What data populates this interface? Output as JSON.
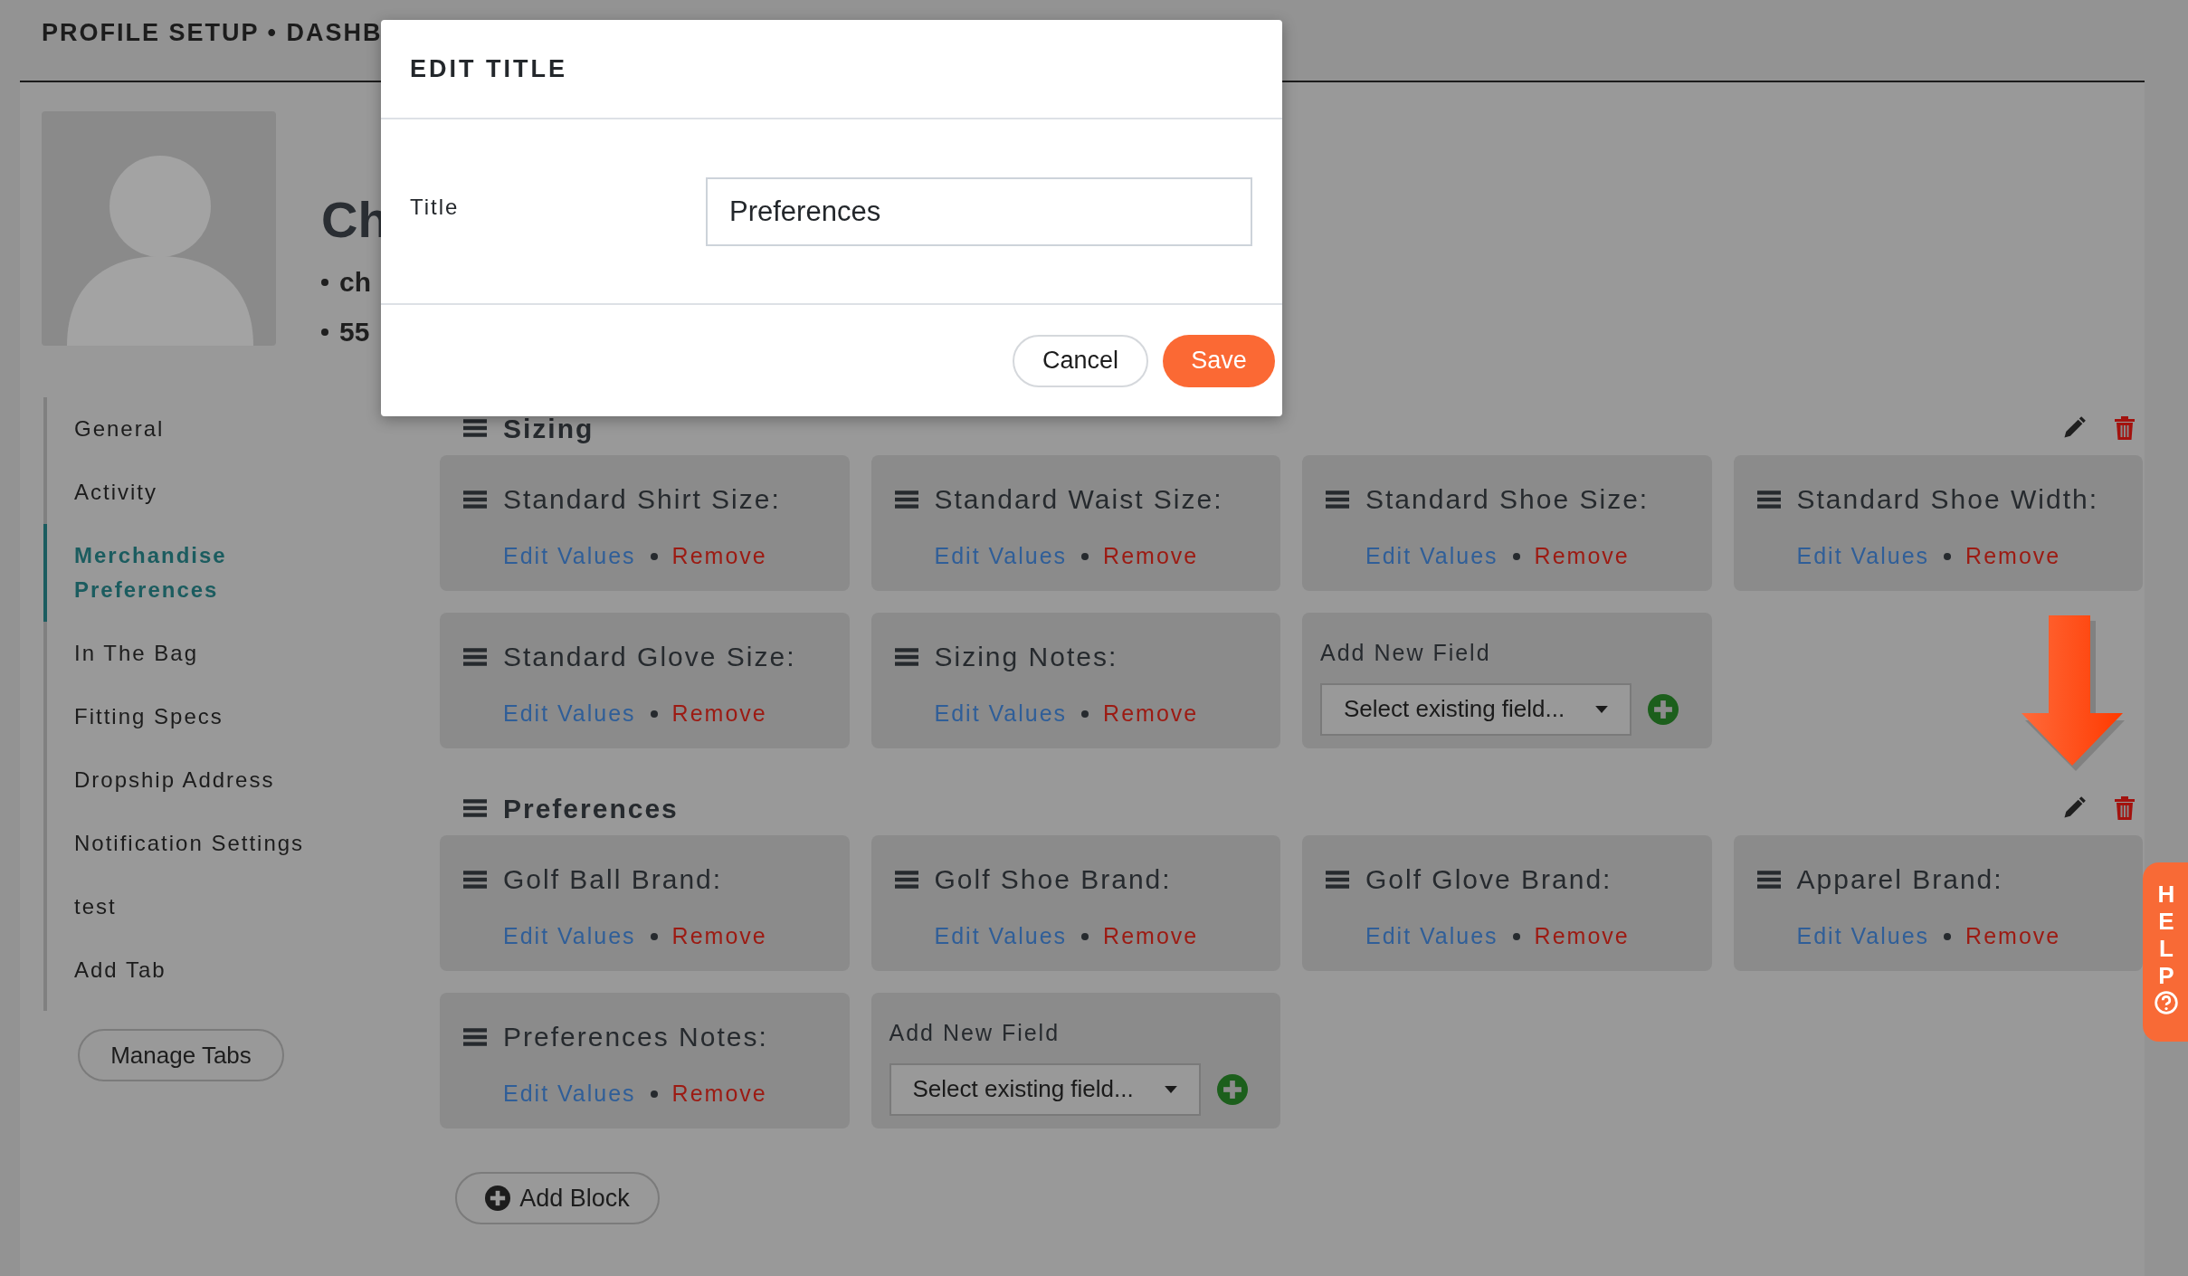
{
  "header": {
    "title": "PROFILE SETUP • DASHB"
  },
  "profile": {
    "name": "Ch",
    "details": [
      "ch",
      "55"
    ]
  },
  "sidebar": {
    "items": [
      {
        "label": "General",
        "selected": false
      },
      {
        "label": "Activity",
        "selected": false
      },
      {
        "label": "Merchandise Preferences",
        "selected": true
      },
      {
        "label": "In The Bag",
        "selected": false
      },
      {
        "label": "Fitting Specs",
        "selected": false
      },
      {
        "label": "Dropship Address",
        "selected": false
      },
      {
        "label": "Notification Settings",
        "selected": false
      },
      {
        "label": "test",
        "selected": false
      },
      {
        "label": "Add Tab",
        "selected": false
      }
    ],
    "manage_button": "Manage Tabs"
  },
  "blocks": [
    {
      "title": "Sizing",
      "fields": [
        {
          "kind": "field",
          "label": "Standard Shirt Size:",
          "edit": "Edit Values",
          "remove": "Remove"
        },
        {
          "kind": "field",
          "label": "Standard Waist Size:",
          "edit": "Edit Values",
          "remove": "Remove"
        },
        {
          "kind": "field",
          "label": "Standard Shoe Size:",
          "edit": "Edit Values",
          "remove": "Remove"
        },
        {
          "kind": "field",
          "label": "Standard Shoe Width:",
          "edit": "Edit Values",
          "remove": "Remove"
        },
        {
          "kind": "field",
          "label": "Standard Glove Size:",
          "edit": "Edit Values",
          "remove": "Remove"
        },
        {
          "kind": "field",
          "label": "Sizing Notes:",
          "edit": "Edit Values",
          "remove": "Remove"
        },
        {
          "kind": "add",
          "label": "Add New Field",
          "select": "Select existing field..."
        }
      ]
    },
    {
      "title": "Preferences",
      "fields": [
        {
          "kind": "field",
          "label": "Golf Ball Brand:",
          "edit": "Edit Values",
          "remove": "Remove"
        },
        {
          "kind": "field",
          "label": "Golf Shoe Brand:",
          "edit": "Edit Values",
          "remove": "Remove"
        },
        {
          "kind": "field",
          "label": "Golf Glove Brand:",
          "edit": "Edit Values",
          "remove": "Remove"
        },
        {
          "kind": "field",
          "label": "Apparel Brand:",
          "edit": "Edit Values",
          "remove": "Remove"
        },
        {
          "kind": "field",
          "label": "Preferences Notes:",
          "edit": "Edit Values",
          "remove": "Remove"
        },
        {
          "kind": "add",
          "label": "Add New Field",
          "select": "Select existing field..."
        }
      ]
    }
  ],
  "add_block_button": "Add Block",
  "help_tab": {
    "label": "HELP"
  },
  "modal": {
    "title": "EDIT TITLE",
    "field_label": "Title",
    "field_value": "Preferences",
    "buttons": [
      {
        "kind": "cancel",
        "label": "Cancel"
      },
      {
        "kind": "save",
        "label": "Save"
      }
    ]
  }
}
